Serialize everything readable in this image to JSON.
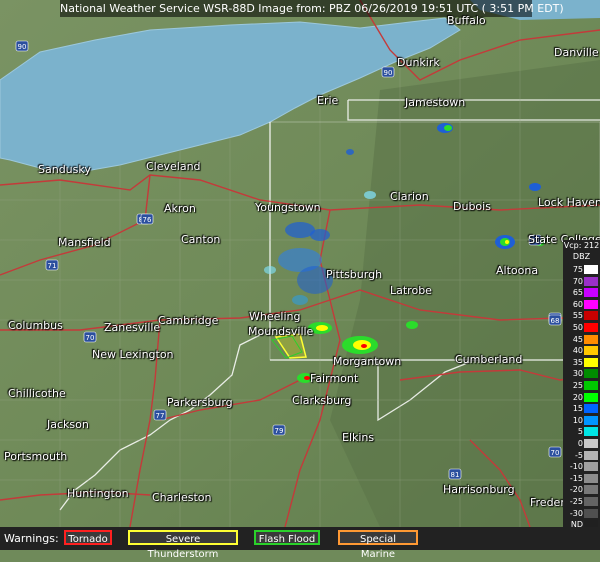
{
  "title": "National Weather Service WSR-88D Image from: PBZ 06/26/2019 19:51 UTC ( 3:51 PM EDT)",
  "cities": [
    {
      "name": "Buffalo"
    },
    {
      "name": "Danville"
    },
    {
      "name": "Dunkirk"
    },
    {
      "name": "Erie"
    },
    {
      "name": "Jamestown"
    },
    {
      "name": "Sandusky"
    },
    {
      "name": "Cleveland"
    },
    {
      "name": "Youngstown"
    },
    {
      "name": "Clarion"
    },
    {
      "name": "Dubois"
    },
    {
      "name": "Lock Haven"
    },
    {
      "name": "Akron"
    },
    {
      "name": "State College"
    },
    {
      "name": "Mansfield"
    },
    {
      "name": "Canton"
    },
    {
      "name": "Pittsburgh"
    },
    {
      "name": "Altoona"
    },
    {
      "name": "Latrobe"
    },
    {
      "name": "Columbus"
    },
    {
      "name": "Zanesville"
    },
    {
      "name": "Cambridge"
    },
    {
      "name": "Wheeling"
    },
    {
      "name": "Moundsville"
    },
    {
      "name": "New Lexington"
    },
    {
      "name": "Morgantown"
    },
    {
      "name": "Cumberland"
    },
    {
      "name": "Fairmont"
    },
    {
      "name": "Chillicothe"
    },
    {
      "name": "Parkersburg"
    },
    {
      "name": "Clarksburg"
    },
    {
      "name": "Jackson"
    },
    {
      "name": "Elkins"
    },
    {
      "name": "Portsmouth"
    },
    {
      "name": "Huntington"
    },
    {
      "name": "Charleston"
    },
    {
      "name": "Harrisonburg"
    },
    {
      "name": "Frederick"
    }
  ],
  "highway_shields": [
    "90",
    "90",
    "80",
    "80",
    "76",
    "71",
    "70",
    "77",
    "79",
    "64",
    "81",
    "99",
    "70",
    "68"
  ],
  "legend": {
    "header_line1": "Vcp: 212",
    "header_line2": "DBZ",
    "items": [
      {
        "label": "75",
        "color": "#ffffff"
      },
      {
        "label": "70",
        "color": "#9a2fc7"
      },
      {
        "label": "65",
        "color": "#c800ff"
      },
      {
        "label": "60",
        "color": "#ff00ff"
      },
      {
        "label": "55",
        "color": "#c80000"
      },
      {
        "label": "50",
        "color": "#ff0000"
      },
      {
        "label": "45",
        "color": "#ff8c00"
      },
      {
        "label": "40",
        "color": "#ffc800"
      },
      {
        "label": "35",
        "color": "#ffff00"
      },
      {
        "label": "30",
        "color": "#008c00"
      },
      {
        "label": "25",
        "color": "#00c800"
      },
      {
        "label": "20",
        "color": "#00ff00"
      },
      {
        "label": "15",
        "color": "#0064ff"
      },
      {
        "label": "10",
        "color": "#0096ff"
      },
      {
        "label": "5",
        "color": "#00e6e6"
      },
      {
        "label": "0",
        "color": "#c8c8c8"
      },
      {
        "label": "-5",
        "color": "#b4b4b4"
      },
      {
        "label": "-10",
        "color": "#a0a0a0"
      },
      {
        "label": "-15",
        "color": "#8c8c8c"
      },
      {
        "label": "-20",
        "color": "#787878"
      },
      {
        "label": "-25",
        "color": "#646464"
      },
      {
        "label": "-30",
        "color": "#505050"
      },
      {
        "label": "ND",
        "color": "#202020"
      }
    ]
  },
  "warnings": {
    "label": "Warnings:",
    "items": [
      {
        "label": "Tornado",
        "color": "#ff2020"
      },
      {
        "label": "Severe Thunderstorm",
        "color": "#ffff33"
      },
      {
        "label": "Flash Flood",
        "color": "#2ad12a"
      },
      {
        "label": "Special Marine",
        "color": "#ff9933"
      }
    ]
  }
}
